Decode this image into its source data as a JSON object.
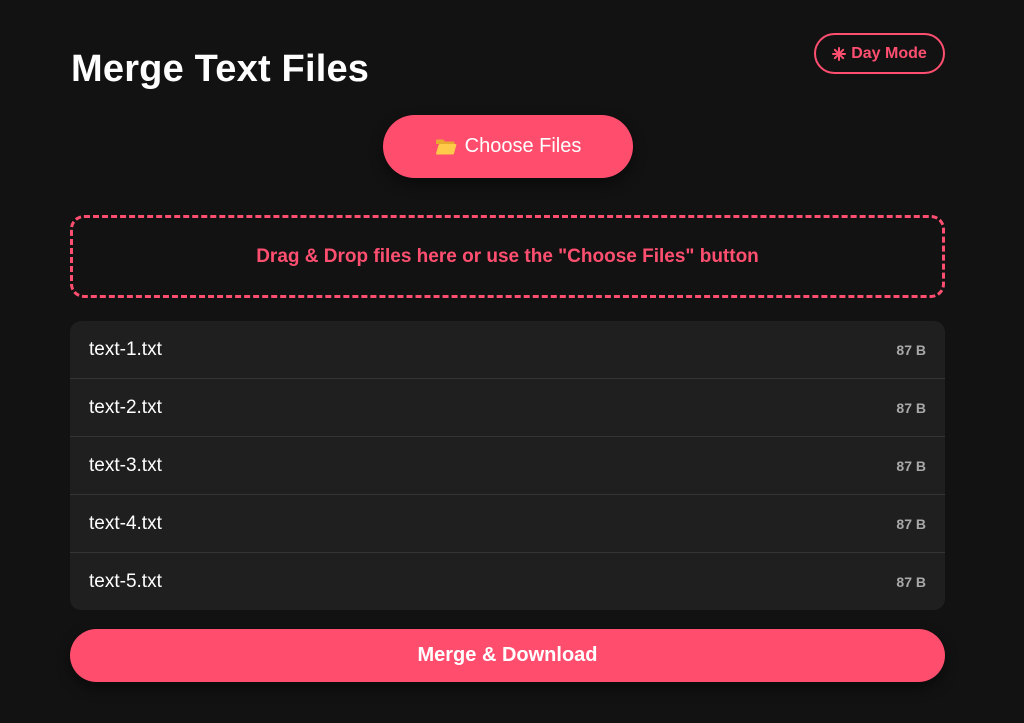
{
  "header": {
    "title": "Merge Text Files",
    "mode_toggle_label": "Day Mode",
    "mode_toggle_icon": "sun-icon"
  },
  "upload": {
    "choose_label": "Choose Files",
    "choose_icon": "folder-icon",
    "drop_text": "Drag & Drop files here or use the \"Choose Files\" button"
  },
  "files": [
    {
      "name": "text-1.txt",
      "size": "87 B"
    },
    {
      "name": "text-2.txt",
      "size": "87 B"
    },
    {
      "name": "text-3.txt",
      "size": "87 B"
    },
    {
      "name": "text-4.txt",
      "size": "87 B"
    },
    {
      "name": "text-5.txt",
      "size": "87 B"
    }
  ],
  "actions": {
    "merge_label": "Merge & Download"
  },
  "colors": {
    "background": "#121212",
    "accent": "#ff4d6d",
    "list_background": "#1f1f1f",
    "folder_icon": "#ffc94a"
  }
}
